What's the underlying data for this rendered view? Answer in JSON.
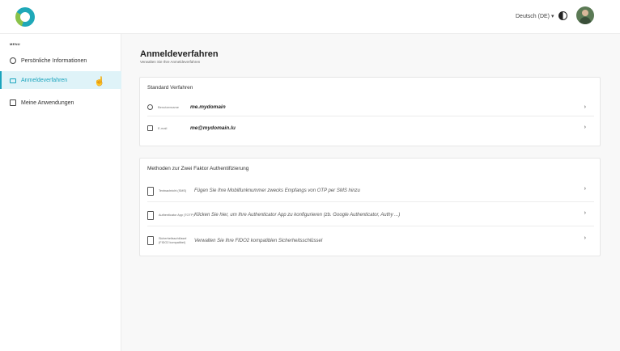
{
  "header": {
    "language": "Deutsch (DE) ▾"
  },
  "sidebar": {
    "menu_title": "MENU",
    "items": [
      {
        "label": "Persönliche Informationen"
      },
      {
        "label": "Anmeldeverfahren"
      },
      {
        "label": "Meine Anwendungen"
      }
    ]
  },
  "main": {
    "title": "Anmeldeverfahren",
    "subtitle": "Verwalten Sie Ihre Anmeldeverfahren",
    "standard": {
      "title": "Standard Verfahren",
      "rows": [
        {
          "label": "Benutzername",
          "value": "me.mydomain"
        },
        {
          "label": "E-mail",
          "value": "me@mydomain.lu"
        }
      ]
    },
    "twofactor": {
      "title": "Methoden zur Zwei Faktor Authentifizierung",
      "rows": [
        {
          "label": "Textnachricht (SMS)",
          "desc": "Fügen Sie Ihre Mobilfunknummer zwecks Empfangs von OTP per SMS hinzu"
        },
        {
          "label": "Authenticator App (TOTP)",
          "desc": "Klicken Sie hier, um Ihre Authenticator App zu konfigurieren (zb. Google Authenticator, Authy ...)"
        },
        {
          "label": "Sicherheitsschlüssel (FIDO2 kompatibel)",
          "desc": "Verwalten Sie Ihre FIDO2 kompatiblen Sicherheitsschlüssel"
        }
      ]
    },
    "chevron": "›"
  },
  "colors": {
    "accent": "#1aa4bd",
    "active_bg": "#dff3f8"
  }
}
